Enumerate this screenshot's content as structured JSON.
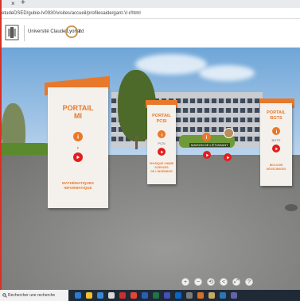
{
  "browser": {
    "url": "etudeDSED/gubie-lv0930/visites/accueil/profilesaide/gant-V-r/html",
    "tab_close_glyph": "×",
    "tab_new_glyph": "+"
  },
  "header": {
    "university": "Université Claude Bernard",
    "city": "Lyon 1",
    "logo_icon": "university-logo-icon"
  },
  "portals": [
    {
      "title_line1": "PORTAIL",
      "title_line2": "MI",
      "small": "p",
      "subtitle_line1": "MATHÉMATIQUES",
      "subtitle_line2": "INFORMATIQUE",
      "icons": [
        "info-icon",
        "play-icon"
      ]
    },
    {
      "title_line1": "PORTAIL",
      "title_line2": "PCSI",
      "small": "PCSI",
      "subtitle_line1": "PHYSIQUE CHIMIE",
      "subtitle_line2": "SCIENCES",
      "subtitle_line3": "DE L'INGÉNIEUR",
      "icons": [
        "info-icon",
        "play-icon"
      ]
    },
    {
      "title_line1": "PORTAIL",
      "title_line2": "BGTS",
      "small": "BGTS",
      "subtitle_line1": "BIOLOGIE",
      "subtitle_line2": "GÉOSCIENCES",
      "icons": [
        "info-icon",
        "play-icon"
      ]
    }
  ],
  "hotspots": {
    "center_label": "MAISON DE L'ÉTUDIANT"
  },
  "nav_controls": [
    "plus-icon",
    "minus-icon",
    "rotate-icon",
    "share-icon",
    "fullscreen-icon",
    "help-icon"
  ],
  "nav_glyphs": [
    "+",
    "−",
    "⟲",
    "<",
    "⤢",
    "?"
  ],
  "taskbar": {
    "search_placeholder": "Rechercher une recherche"
  },
  "colors": {
    "accent_orange": "#e8782a",
    "play_red": "#e21e1e",
    "taskbar": "#1f2a36"
  }
}
